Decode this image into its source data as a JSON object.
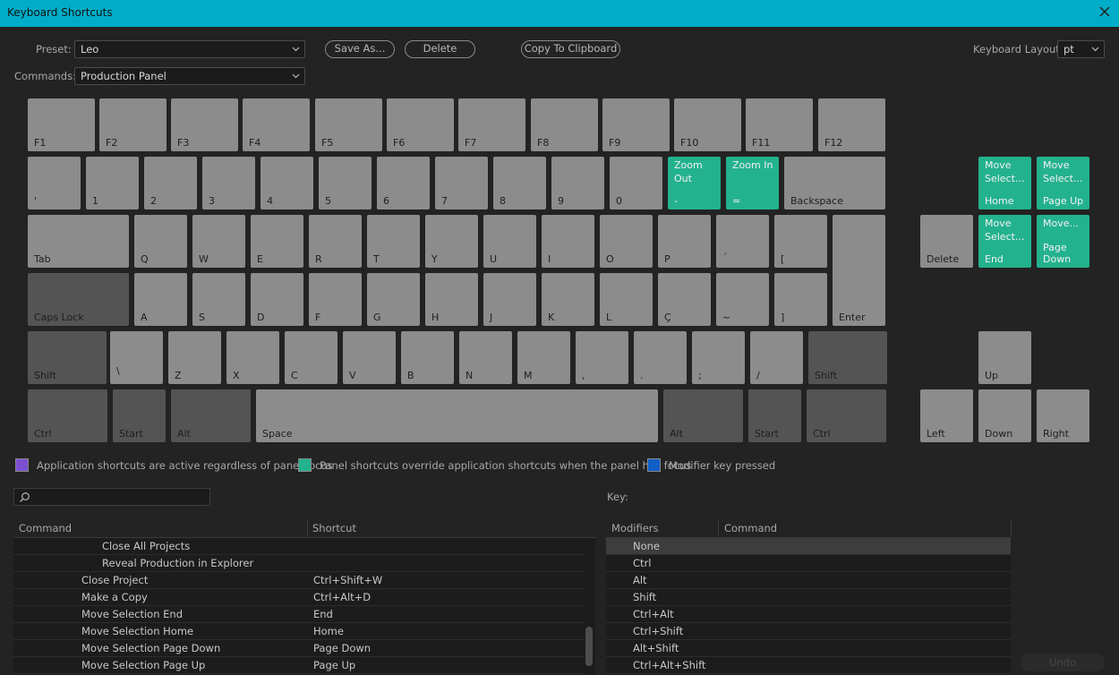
{
  "window": {
    "title": "Keyboard Shortcuts"
  },
  "toolbar": {
    "preset_label": "Preset:",
    "preset_value": "Leo",
    "save_as": "Save As...",
    "delete": "Delete",
    "copy": "Copy To Clipboard",
    "layout_label": "Keyboard Layout:",
    "layout_value": "pt",
    "commands_label": "Commands:",
    "commands_value": "Production Panel"
  },
  "keys": {
    "f1": "F1",
    "f2": "F2",
    "f3": "F3",
    "f4": "F4",
    "f5": "F5",
    "f6": "F6",
    "f7": "F7",
    "f8": "F8",
    "f9": "F9",
    "f10": "F10",
    "f11": "F11",
    "f12": "F12",
    "backtick": "'",
    "n1": "1",
    "n2": "2",
    "n3": "3",
    "n4": "4",
    "n5": "5",
    "n6": "6",
    "n7": "7",
    "n8": "8",
    "n9": "9",
    "n0": "0",
    "minus": "-",
    "equals": "=",
    "backspace": "Backspace",
    "tab": "Tab",
    "q": "Q",
    "w": "W",
    "e": "E",
    "r": "R",
    "t": "T",
    "y": "Y",
    "u": "U",
    "i": "I",
    "o": "O",
    "p": "P",
    "acute": "´",
    "lbracket": "[",
    "caps": "Caps Lock",
    "a": "A",
    "s": "S",
    "d": "D",
    "f": "F",
    "g": "G",
    "h": "H",
    "j": "J",
    "k": "K",
    "l": "L",
    "cced": "Ç",
    "tilde": "~",
    "rbracket": "]",
    "enter": "Enter",
    "lshift": "Shift",
    "backslash": "\\",
    "z": "Z",
    "x": "X",
    "c": "C",
    "v": "V",
    "b": "B",
    "n": "N",
    "m": "M",
    "comma": ",",
    "period": ".",
    "semicolon": ";",
    "slash": "/",
    "rshift": "Shift",
    "lctrl": "Ctrl",
    "lstart": "Start",
    "lalt": "Alt",
    "space": "Space",
    "ralt": "Alt",
    "rstart": "Start",
    "rctrl": "Ctrl",
    "home": "Home",
    "pageup": "Page Up",
    "delete": "Delete",
    "end": "End",
    "pagedown": "Page\nDown",
    "up": "Up",
    "left": "Left",
    "down": "Down",
    "right": "Right"
  },
  "assigned": {
    "zoom_out": "Zoom\nOut",
    "zoom_in": "Zoom In",
    "home_cmd": "Move\nSelect...",
    "pageup_cmd": "Move\nSelect...",
    "end_cmd": "Move\nSelect...",
    "pagedown_cmd": "Move..."
  },
  "legend": {
    "app": {
      "text": "Application shortcuts are active regardless of panel focus",
      "color": "#7b4fd0"
    },
    "panel": {
      "text": "Panel shortcuts override application shortcuts when the panel has focus",
      "color": "#23b28e"
    },
    "modifier": {
      "text": "Modifier key pressed",
      "color": "#1060c8"
    }
  },
  "key_label": "Key:",
  "commands_table": {
    "headers": {
      "command": "Command",
      "shortcut": "Shortcut"
    },
    "rows": [
      {
        "command": "Close All Projects",
        "shortcut": ""
      },
      {
        "command": "Reveal Production in Explorer",
        "shortcut": ""
      },
      {
        "command": "Close Project",
        "shortcut": "Ctrl+Shift+W"
      },
      {
        "command": "Make a Copy",
        "shortcut": "Ctrl+Alt+D"
      },
      {
        "command": "Move Selection End",
        "shortcut": "End"
      },
      {
        "command": "Move Selection Home",
        "shortcut": "Home"
      },
      {
        "command": "Move Selection Page Down",
        "shortcut": "Page Down"
      },
      {
        "command": "Move Selection Page Up",
        "shortcut": "Page Up"
      }
    ]
  },
  "modifiers_table": {
    "headers": {
      "modifiers": "Modifiers",
      "command": "Command"
    },
    "rows": [
      "None",
      "Ctrl",
      "Alt",
      "Shift",
      "Ctrl+Alt",
      "Ctrl+Shift",
      "Alt+Shift",
      "Ctrl+Alt+Shift"
    ]
  },
  "undo": "Undo"
}
